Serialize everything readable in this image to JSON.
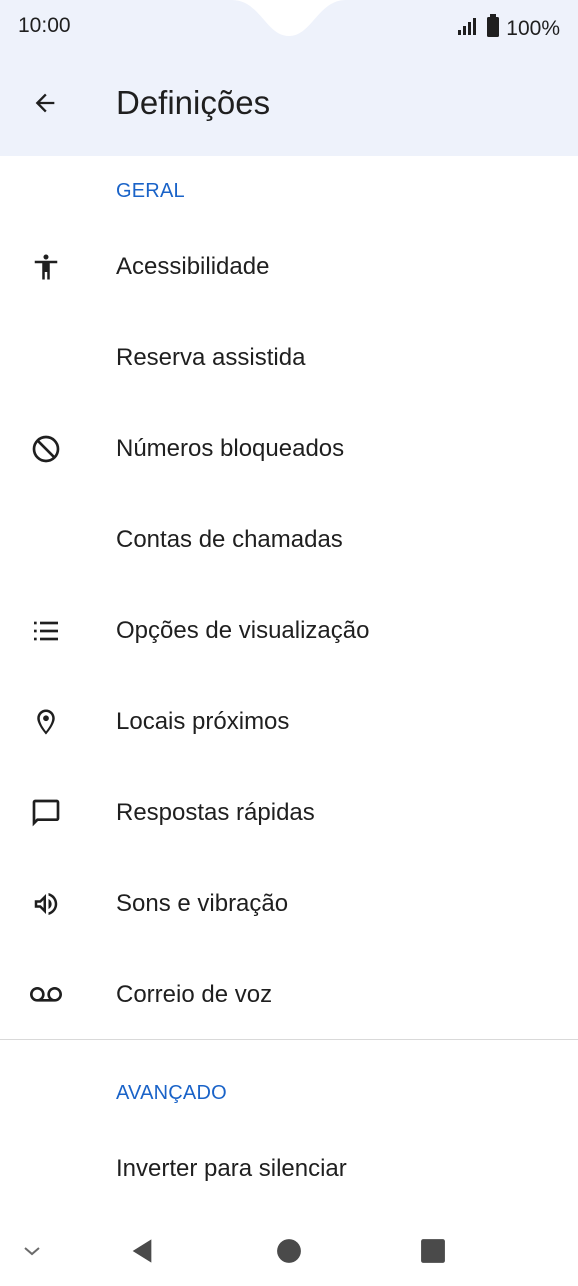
{
  "status_bar": {
    "time": "10:00",
    "battery": "100%",
    "signal_icon": "signal-icon",
    "battery_icon": "battery-icon"
  },
  "app_bar": {
    "back_icon": "arrow-back-icon",
    "title": "Definições"
  },
  "sections": [
    {
      "header": "GERAL",
      "items": [
        {
          "label": "Acessibilidade",
          "icon": "accessibility-icon"
        },
        {
          "label": "Reserva assistida",
          "icon": ""
        },
        {
          "label": "Números bloqueados",
          "icon": "block-icon"
        },
        {
          "label": "Contas de chamadas",
          "icon": ""
        },
        {
          "label": "Opções de visualização",
          "icon": "list-icon"
        },
        {
          "label": "Locais próximos",
          "icon": "location-icon"
        },
        {
          "label": "Respostas rápidas",
          "icon": "message-icon"
        },
        {
          "label": "Sons e vibração",
          "icon": "volume-icon"
        },
        {
          "label": "Correio de voz",
          "icon": "voicemail-icon"
        }
      ]
    },
    {
      "header": "AVANÇADO",
      "items": [
        {
          "label": "Inverter para silenciar",
          "icon": ""
        }
      ]
    }
  ],
  "colors": {
    "accent": "#1a63c8",
    "header_bg": "#eef2fb",
    "text": "#1f1f1f",
    "icon": "#1f1f1f"
  },
  "nav_bar": {
    "icons": [
      "chevron-down-icon",
      "back-triangle-icon",
      "home-circle-icon",
      "recents-square-icon"
    ]
  }
}
